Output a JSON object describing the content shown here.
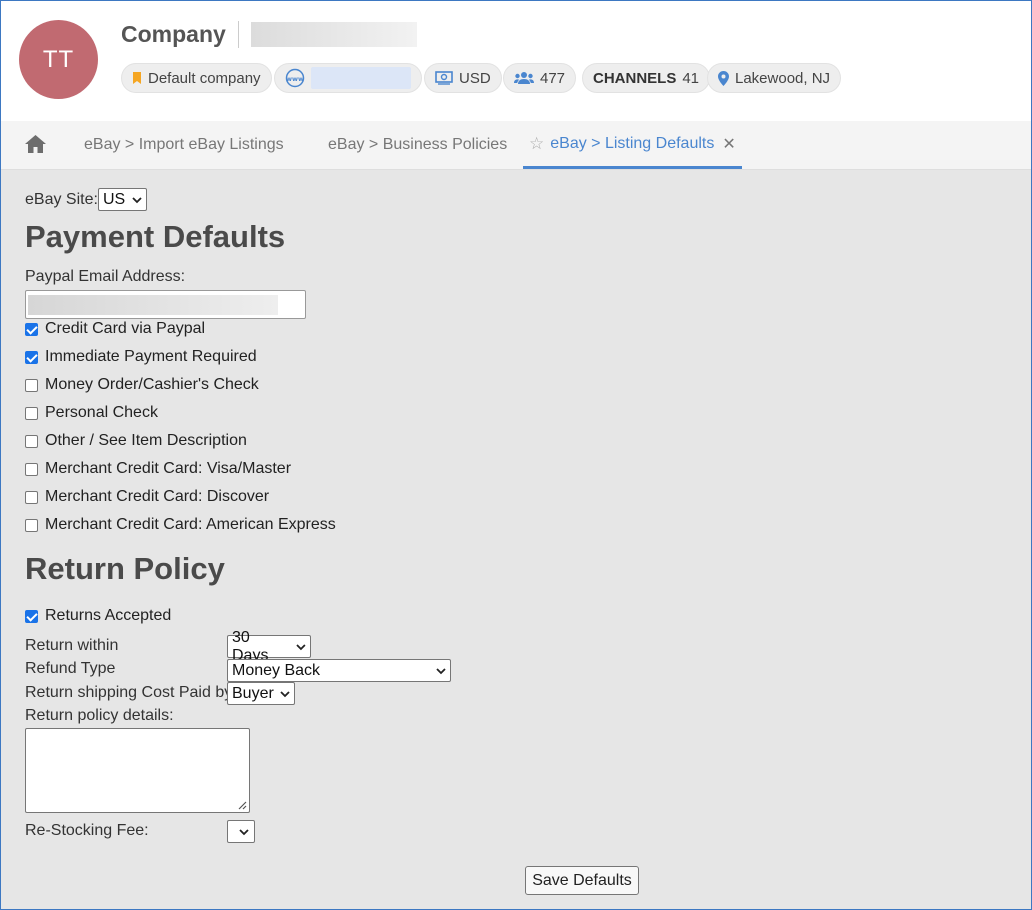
{
  "header": {
    "avatar_initials": "TT",
    "company_title": "Company",
    "pills": {
      "default_company": "Default company",
      "currency": "USD",
      "users_count": "477",
      "channels_label": "CHANNELS",
      "channels_count": "41",
      "location": "Lakewood, NJ"
    }
  },
  "tabs": {
    "items": [
      {
        "label": "eBay > Import eBay Listings"
      },
      {
        "label": "eBay > Business Policies"
      },
      {
        "label": "eBay > Listing Defaults"
      }
    ],
    "close_glyph": "✕",
    "star_glyph": "☆"
  },
  "ebay_site": {
    "label": "eBay Site:",
    "value": "US"
  },
  "payment": {
    "heading": "Payment Defaults",
    "paypal_label": "Paypal Email Address:",
    "options": [
      {
        "label": "Credit Card via Paypal",
        "checked": true
      },
      {
        "label": "Immediate Payment Required",
        "checked": true
      },
      {
        "label": "Money Order/Cashier's Check",
        "checked": false
      },
      {
        "label": "Personal Check",
        "checked": false
      },
      {
        "label": "Other / See Item Description",
        "checked": false
      },
      {
        "label": "Merchant Credit Card: Visa/Master",
        "checked": false
      },
      {
        "label": "Merchant Credit Card: Discover",
        "checked": false
      },
      {
        "label": "Merchant Credit Card: American Express",
        "checked": false
      }
    ]
  },
  "returns": {
    "heading": "Return Policy",
    "accepted_label": "Returns Accepted",
    "accepted_checked": true,
    "within_label": "Return within",
    "within_value": "30 Days",
    "refund_label": "Refund Type",
    "refund_value": "Money Back",
    "shipping_label": "Return shipping Cost Paid by",
    "shipping_value": "Buyer",
    "details_label": "Return policy details:",
    "restocking_label": "Re-Stocking Fee:",
    "restocking_value": ""
  },
  "save_label": "Save Defaults",
  "colors": {
    "accent": "#4a86cf",
    "avatar": "#c16a71",
    "background": "#e6e6e6"
  }
}
